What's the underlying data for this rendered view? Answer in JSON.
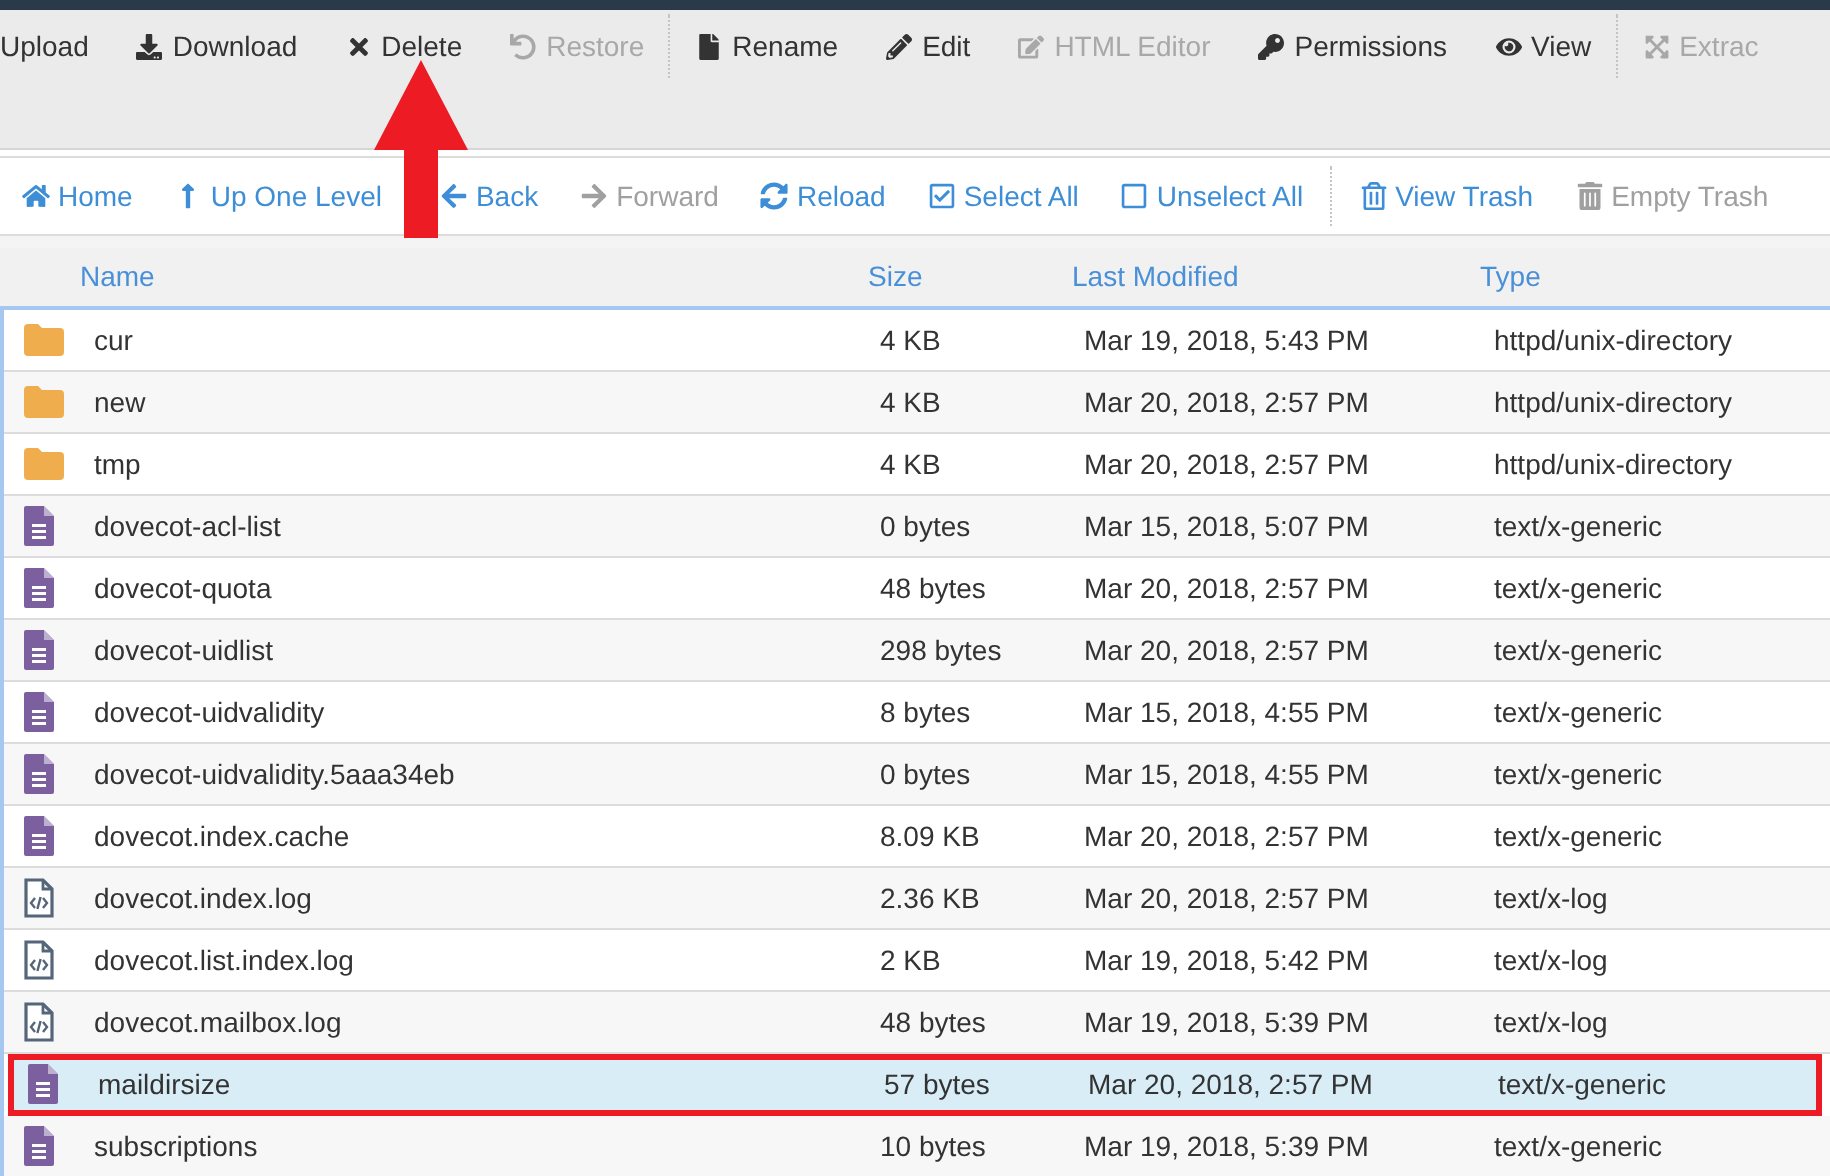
{
  "toolbar": [
    {
      "label": "Upload",
      "disabled": false,
      "separator_after": false
    },
    {
      "label": "Download",
      "disabled": false,
      "separator_after": false
    },
    {
      "label": "Delete",
      "disabled": false,
      "separator_after": false
    },
    {
      "label": "Restore",
      "disabled": true,
      "separator_after": true
    },
    {
      "label": "Rename",
      "disabled": false,
      "separator_after": false
    },
    {
      "label": "Edit",
      "disabled": false,
      "separator_after": false
    },
    {
      "label": "HTML Editor",
      "disabled": true,
      "separator_after": false
    },
    {
      "label": "Permissions",
      "disabled": false,
      "separator_after": false
    },
    {
      "label": "View",
      "disabled": false,
      "separator_after": true
    },
    {
      "label": "Extrac",
      "disabled": true,
      "separator_after": false
    }
  ],
  "navbar": [
    {
      "label": "Home",
      "disabled": false,
      "separator_after": false
    },
    {
      "label": "Up One Level",
      "disabled": false,
      "separator_after": false
    },
    {
      "label": "Back",
      "disabled": false,
      "separator_after": false
    },
    {
      "label": "Forward",
      "disabled": true,
      "separator_after": false
    },
    {
      "label": "Reload",
      "disabled": false,
      "separator_after": false
    },
    {
      "label": "Select All",
      "disabled": false,
      "separator_after": false
    },
    {
      "label": "Unselect All",
      "disabled": false,
      "separator_after": true
    },
    {
      "label": "View Trash",
      "disabled": false,
      "separator_after": false
    },
    {
      "label": "Empty Trash",
      "disabled": true,
      "separator_after": false
    }
  ],
  "table": {
    "columns": [
      "Name",
      "Size",
      "Last Modified",
      "Type"
    ],
    "rows": [
      {
        "kind": "folder",
        "name": "cur",
        "size": "4 KB",
        "modified": "Mar 19, 2018, 5:43 PM",
        "type": "httpd/unix-directory",
        "selected": false,
        "marked": false
      },
      {
        "kind": "folder",
        "name": "new",
        "size": "4 KB",
        "modified": "Mar 20, 2018, 2:57 PM",
        "type": "httpd/unix-directory",
        "selected": false,
        "marked": false
      },
      {
        "kind": "folder",
        "name": "tmp",
        "size": "4 KB",
        "modified": "Mar 20, 2018, 2:57 PM",
        "type": "httpd/unix-directory",
        "selected": false,
        "marked": false
      },
      {
        "kind": "text",
        "name": "dovecot-acl-list",
        "size": "0 bytes",
        "modified": "Mar 15, 2018, 5:07 PM",
        "type": "text/x-generic",
        "selected": false,
        "marked": false
      },
      {
        "kind": "text",
        "name": "dovecot-quota",
        "size": "48 bytes",
        "modified": "Mar 20, 2018, 2:57 PM",
        "type": "text/x-generic",
        "selected": false,
        "marked": false
      },
      {
        "kind": "text",
        "name": "dovecot-uidlist",
        "size": "298 bytes",
        "modified": "Mar 20, 2018, 2:57 PM",
        "type": "text/x-generic",
        "selected": false,
        "marked": false
      },
      {
        "kind": "text",
        "name": "dovecot-uidvalidity",
        "size": "8 bytes",
        "modified": "Mar 15, 2018, 4:55 PM",
        "type": "text/x-generic",
        "selected": false,
        "marked": false
      },
      {
        "kind": "text",
        "name": "dovecot-uidvalidity.5aaa34eb",
        "size": "0 bytes",
        "modified": "Mar 15, 2018, 4:55 PM",
        "type": "text/x-generic",
        "selected": false,
        "marked": false
      },
      {
        "kind": "text",
        "name": "dovecot.index.cache",
        "size": "8.09 KB",
        "modified": "Mar 20, 2018, 2:57 PM",
        "type": "text/x-generic",
        "selected": false,
        "marked": false
      },
      {
        "kind": "code",
        "name": "dovecot.index.log",
        "size": "2.36 KB",
        "modified": "Mar 20, 2018, 2:57 PM",
        "type": "text/x-log",
        "selected": false,
        "marked": false
      },
      {
        "kind": "code",
        "name": "dovecot.list.index.log",
        "size": "2 KB",
        "modified": "Mar 19, 2018, 5:42 PM",
        "type": "text/x-log",
        "selected": false,
        "marked": false
      },
      {
        "kind": "code",
        "name": "dovecot.mailbox.log",
        "size": "48 bytes",
        "modified": "Mar 19, 2018, 5:39 PM",
        "type": "text/x-log",
        "selected": false,
        "marked": false
      },
      {
        "kind": "text",
        "name": "maildirsize",
        "size": "57 bytes",
        "modified": "Mar 20, 2018, 2:57 PM",
        "type": "text/x-generic",
        "selected": true,
        "marked": true
      },
      {
        "kind": "text",
        "name": "subscriptions",
        "size": "10 bytes",
        "modified": "Mar 19, 2018, 5:39 PM",
        "type": "text/x-generic",
        "selected": false,
        "marked": false
      }
    ]
  }
}
